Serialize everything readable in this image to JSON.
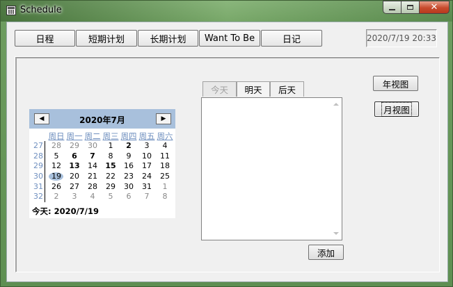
{
  "window": {
    "title": "Schedule",
    "close_glyph": "✕",
    "icons": {
      "app": "calendar-app-icon",
      "minimize": "minimize-icon",
      "maximize": "maximize-icon",
      "close": "close-icon"
    }
  },
  "tabs": [
    {
      "label": "日程"
    },
    {
      "label": "短期计划"
    },
    {
      "label": "长期计划"
    },
    {
      "label": "Want To Be"
    },
    {
      "label": "日记"
    }
  ],
  "datetime": "2020/7/19 20:33",
  "calendar": {
    "title": "2020年7月",
    "prev_glyph": "◀",
    "next_glyph": "▶",
    "weekdays": [
      "周日",
      "周一",
      "周二",
      "周三",
      "周四",
      "周五",
      "周六"
    ],
    "week_numbers": [
      "27",
      "28",
      "29",
      "30",
      "31",
      "32"
    ],
    "weeks": [
      [
        {
          "d": "28",
          "o": true
        },
        {
          "d": "29",
          "o": true
        },
        {
          "d": "30",
          "o": true
        },
        {
          "d": "1"
        },
        {
          "d": "2",
          "b": true
        },
        {
          "d": "3"
        },
        {
          "d": "4"
        }
      ],
      [
        {
          "d": "5"
        },
        {
          "d": "6",
          "b": true
        },
        {
          "d": "7",
          "b": true
        },
        {
          "d": "8"
        },
        {
          "d": "9"
        },
        {
          "d": "10"
        },
        {
          "d": "11"
        }
      ],
      [
        {
          "d": "12"
        },
        {
          "d": "13",
          "b": true
        },
        {
          "d": "14"
        },
        {
          "d": "15",
          "b": true
        },
        {
          "d": "16"
        },
        {
          "d": "17"
        },
        {
          "d": "18"
        }
      ],
      [
        {
          "d": "19",
          "t": true
        },
        {
          "d": "20"
        },
        {
          "d": "21"
        },
        {
          "d": "22"
        },
        {
          "d": "23"
        },
        {
          "d": "24"
        },
        {
          "d": "25"
        }
      ],
      [
        {
          "d": "26"
        },
        {
          "d": "27"
        },
        {
          "d": "28"
        },
        {
          "d": "29"
        },
        {
          "d": "30"
        },
        {
          "d": "31"
        },
        {
          "d": "1",
          "o": true
        }
      ],
      [
        {
          "d": "2",
          "o": true
        },
        {
          "d": "3",
          "o": true
        },
        {
          "d": "4",
          "o": true
        },
        {
          "d": "5",
          "o": true
        },
        {
          "d": "6",
          "o": true
        },
        {
          "d": "7",
          "o": true
        },
        {
          "d": "8",
          "o": true
        }
      ]
    ],
    "today_label": "今天: 2020/7/19",
    "accent_color": "#a8c0dc"
  },
  "day_tabs": [
    {
      "label": "今天",
      "state": "disabled"
    },
    {
      "label": "明天",
      "state": "normal"
    },
    {
      "label": "后天",
      "state": "normal"
    }
  ],
  "buttons": {
    "year_view": "年视图",
    "month_view": "月视图",
    "add": "添加"
  }
}
